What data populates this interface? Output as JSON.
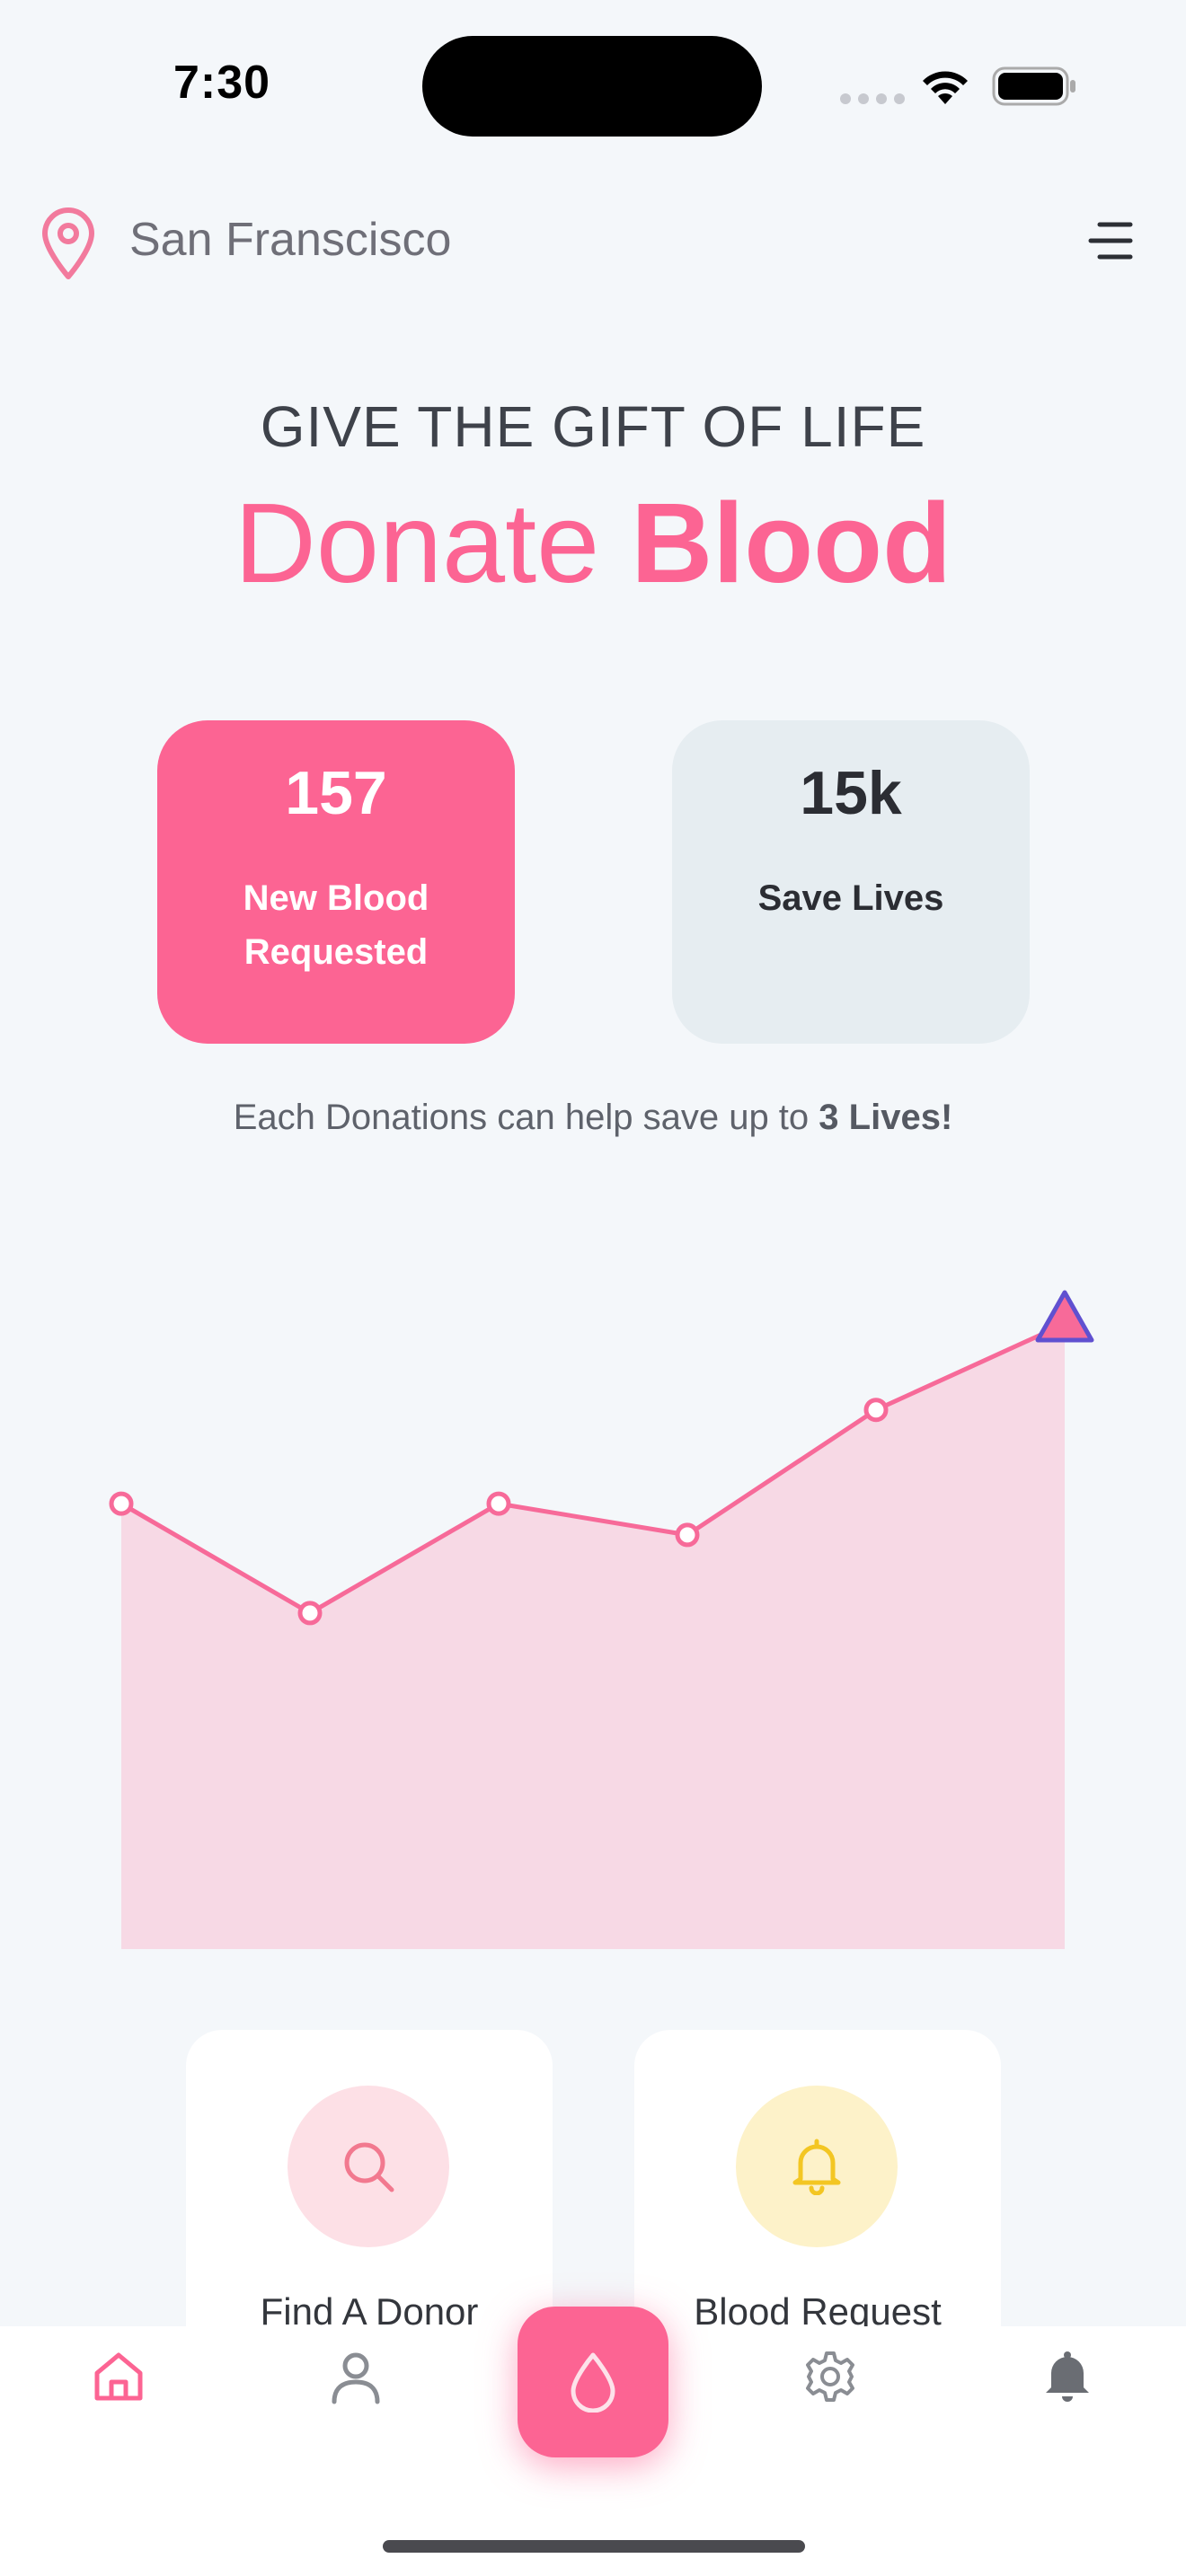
{
  "status_bar": {
    "time": "7:30"
  },
  "header": {
    "location": "San Franscisco",
    "location_icon": "map-pin-icon",
    "menu_icon": "menu-icon"
  },
  "hero": {
    "tagline": "GIVE THE GIFT OF LIFE",
    "headline_light": "Donate",
    "headline_bold": "Blood"
  },
  "stats": [
    {
      "value": "157",
      "label": "New Blood Requested"
    },
    {
      "value": "15k",
      "label": "Save Lives"
    }
  ],
  "note": {
    "text": "Each Donations can help save up to",
    "highlight": "3 Lives!"
  },
  "chart_data": {
    "type": "area",
    "series": [
      {
        "values": [
          57,
          43,
          57,
          53,
          69,
          80
        ]
      }
    ],
    "ylim": [
      0,
      100
    ],
    "color": "#f76a99",
    "fill": "#f7d9e5",
    "marker_last": "triangle"
  },
  "actions": [
    {
      "label": "Find A Donor",
      "icon": "search-icon",
      "bg": "#fde0e6",
      "color": "#f2798f"
    },
    {
      "label": "Blood Request",
      "icon": "bell-icon",
      "bg": "#fdf2c9",
      "color": "#f3c623"
    }
  ],
  "tabbar": {
    "items": [
      "home-icon",
      "user-icon",
      "blood-drop-icon",
      "settings-icon",
      "notification-icon"
    ],
    "active": "home-icon"
  },
  "colors": {
    "accent": "#fc6493",
    "background": "#f4f7fa"
  }
}
